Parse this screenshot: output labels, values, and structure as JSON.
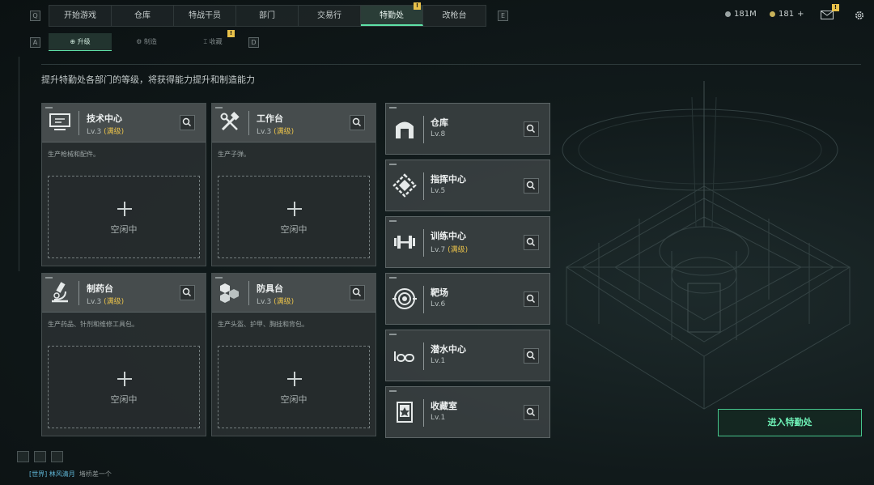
{
  "topbar": {
    "key_left": "Q",
    "key_right": "E",
    "tabs": [
      {
        "label": "开始游戏"
      },
      {
        "label": "仓库"
      },
      {
        "label": "特战干员"
      },
      {
        "label": "部门"
      },
      {
        "label": "交易行"
      },
      {
        "label": "特勤处",
        "active": true,
        "badge": "!"
      },
      {
        "label": "改枪台"
      }
    ],
    "currency_a": "181M",
    "currency_b": "181",
    "currency_b_add": "+",
    "mail_badge": "!"
  },
  "subtabs": {
    "key_left": "A",
    "key_right": "D",
    "items": [
      {
        "label": "升级",
        "active": true
      },
      {
        "label": "制造"
      },
      {
        "label": "收藏",
        "badge": "!"
      }
    ]
  },
  "description": "提升特勤处各部门的等级，将获得能力提升和制造能力",
  "workshops": [
    {
      "title": "技术中心",
      "level": "Lv.3",
      "maxed": "(满级)",
      "desc": "生产枪械和配件。",
      "slot": "空闲中",
      "icon": "computer-icon"
    },
    {
      "title": "工作台",
      "level": "Lv.3",
      "maxed": "(满级)",
      "desc": "生产子弹。",
      "slot": "空闲中",
      "icon": "tools-icon"
    },
    {
      "title": "制药台",
      "level": "Lv.3",
      "maxed": "(满级)",
      "desc": "生产药品、针剂和维修工具包。",
      "slot": "空闲中",
      "icon": "microscope-icon"
    },
    {
      "title": "防具台",
      "level": "Lv.3",
      "maxed": "(满级)",
      "desc": "生产头盔、护甲、胸挂和背包。",
      "slot": "空闲中",
      "icon": "cubes-icon"
    }
  ],
  "rooms": [
    {
      "title": "仓库",
      "level": "Lv.8",
      "maxed": "",
      "icon": "warehouse-icon"
    },
    {
      "title": "指挥中心",
      "level": "Lv.5",
      "maxed": "",
      "icon": "command-icon"
    },
    {
      "title": "训练中心",
      "level": "Lv.7",
      "maxed": "(满级)",
      "icon": "dumbbell-icon"
    },
    {
      "title": "靶场",
      "level": "Lv.6",
      "maxed": "",
      "icon": "target-icon"
    },
    {
      "title": "潜水中心",
      "level": "Lv.1",
      "maxed": "",
      "icon": "diving-mask-icon"
    },
    {
      "title": "收藏室",
      "level": "Lv.1",
      "maxed": "",
      "icon": "trophy-case-icon"
    }
  ],
  "enter_button": "进入特勤处",
  "chat": {
    "channel": "[世界]",
    "user": "林风清月",
    "message": "堵桥差一个"
  },
  "colors": {
    "accent": "#5fe2a8",
    "maxed": "#e8c14a",
    "badge": "#e8c14a"
  }
}
